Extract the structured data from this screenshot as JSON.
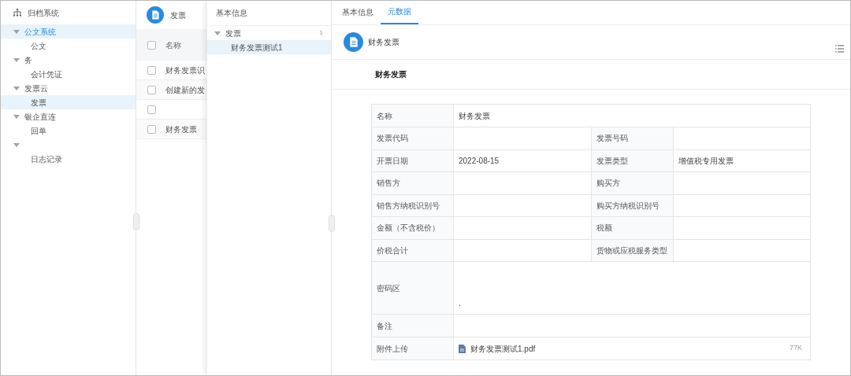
{
  "sidebar": {
    "title": "归档系统",
    "items": [
      {
        "label": "公文系统",
        "expanded": true,
        "active": true,
        "children": [
          {
            "label": "公文",
            "selected": false
          }
        ]
      },
      {
        "label": "务",
        "expanded": true,
        "active": false,
        "children": [
          {
            "label": "会计凭证",
            "selected": false
          }
        ]
      },
      {
        "label": "发票云",
        "expanded": true,
        "active": false,
        "children": [
          {
            "label": "发票",
            "selected": true
          }
        ]
      },
      {
        "label": "银企直连",
        "expanded": true,
        "active": false,
        "children": [
          {
            "label": "回单",
            "selected": false
          }
        ]
      },
      {
        "expanded": true,
        "active": false,
        "children": [
          {
            "label": "日志记录",
            "selected": false
          }
        ]
      }
    ]
  },
  "list_panel": {
    "title": "发票",
    "columns": [
      "名称"
    ],
    "all_checked": false,
    "rows": [
      {
        "name": "财务发票识",
        "checked": false
      },
      {
        "name": "创建新的发",
        "checked": false
      },
      {
        "checked": false
      },
      {
        "name": "财务发票",
        "checked": false
      }
    ]
  },
  "info_panel": {
    "title": "基本信息",
    "tree": [
      {
        "label": "发票",
        "count": "1",
        "expanded": true,
        "children": [
          {
            "label": "财务发票测试1",
            "selected": true
          }
        ]
      }
    ]
  },
  "detail": {
    "tabs": [
      {
        "label": "基本信息",
        "selected": false
      },
      {
        "label": "元数据",
        "selected": true
      }
    ],
    "header_title": "财务发票",
    "section_title": "财务发票",
    "table": [
      {
        "kind": "full",
        "label": "名称",
        "value": "财务发票"
      },
      {
        "kind": "pair",
        "cells": [
          {
            "label": "发票代码"
          },
          {
            "label": "发票号码"
          }
        ]
      },
      {
        "kind": "pair",
        "cells": [
          {
            "label": "开票日期",
            "value": "2022-08-15"
          },
          {
            "label": "发票类型",
            "value": "增值税专用发票"
          }
        ]
      },
      {
        "kind": "pair",
        "cells": [
          {
            "label": "销售方"
          },
          {
            "label": "购买方"
          }
        ]
      },
      {
        "kind": "pair",
        "cells": [
          {
            "label": "销售方纳税识别号"
          },
          {
            "label": "购买方纳税识别号"
          }
        ]
      },
      {
        "kind": "pair",
        "cells": [
          {
            "label": "金额（不含税价）"
          },
          {
            "label": "税额"
          }
        ]
      },
      {
        "kind": "pair",
        "cells": [
          {
            "label": "价税合计"
          },
          {
            "label": "货物或应税服务类型"
          }
        ]
      },
      {
        "kind": "tall",
        "label": "密码区",
        "value": "."
      },
      {
        "kind": "full",
        "label": "备注"
      },
      {
        "kind": "file",
        "label": "附件上传",
        "file": "财务发票测试1.pdf",
        "size": "77K"
      }
    ]
  }
}
